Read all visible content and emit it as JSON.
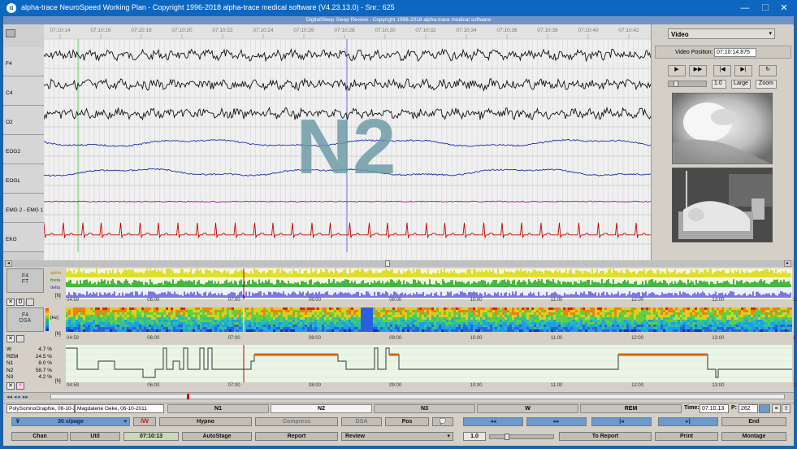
{
  "window": {
    "title": "alpha-trace NeuroSpeed Working Plan - Copyright 1996-2018 alpha-trace medical software (V4.23.13.0) - Snr.: 625",
    "minimize_glyph": "—",
    "maximize_glyph": "☐",
    "close_glyph": "✕",
    "app_glyph": "α"
  },
  "banner": "DigitalSleep Sleep Review - Copyright 1996-2018 alpha-trace medical software",
  "time_ticks": [
    "07:10:14",
    "07:10:16",
    "07:10:18",
    "07:10:20",
    "07:10:22",
    "07:10:24",
    "07:10:26",
    "07:10:28",
    "07:10:30",
    "07:10:32",
    "07:10:34",
    "07:10:36",
    "07:10:38",
    "07:10:40",
    "07:10:42"
  ],
  "channels": [
    "F4",
    "C4",
    "O2",
    "EOG2",
    "EOGL",
    "EMG 2 - EMG 1",
    "EKG"
  ],
  "stage_overlay": "N2",
  "video": {
    "dropdown": "Video",
    "position_label": "Video Position:",
    "position_value": "07:10:14.875",
    "speed_value": "1.0",
    "large_label": "Large",
    "zoom_label": "Zoom"
  },
  "trend_ft": {
    "name_top": "F4",
    "name_bottom": "FT",
    "bands": [
      "alpha",
      "theta",
      "delta"
    ]
  },
  "trend_dsa": {
    "name_top": "F4",
    "name_bottom": "DSA",
    "unit": "[Hz]"
  },
  "hour_axis": {
    "unit": "[h]",
    "ticks": [
      "04:59",
      "06:00",
      "07:00",
      "08:00",
      "09:00",
      "10:00",
      "11:00",
      "12:00",
      "13:00",
      "13:59"
    ]
  },
  "hypno_stats": [
    {
      "stage": "W",
      "pct": "4.7 %"
    },
    {
      "stage": "REM",
      "pct": "24.5 %"
    },
    {
      "stage": "N1",
      "pct": "8.0 %"
    },
    {
      "stage": "N2",
      "pct": "58.7 %"
    },
    {
      "stage": "N3",
      "pct": "4.2 %"
    }
  ],
  "stage_bar": {
    "file": "PolySomnoGraphie, 06-10-2",
    "patient": "Magdalene Geke, 06-10-2011",
    "stages": [
      "N1",
      "N2",
      "N3",
      "W",
      "REM"
    ],
    "time_label": "Time:",
    "time_value": "07.10.13",
    "page_label": "P:",
    "page_value": "262"
  },
  "toolbar1": {
    "page_speed": "30 s/page",
    "hypno": "Hypno",
    "compress": "Compress",
    "dsa": "DSA",
    "pos": "Pos",
    "rewind": "◂◂",
    "forward": "▸▸",
    "prev": "|◂",
    "next": "▸|",
    "end": "End"
  },
  "toolbar2": {
    "chan": "Chan",
    "util": "Util",
    "time": "07:10:13",
    "autostage": "AutoStage",
    "report": "Report",
    "review": "Review",
    "gain": "1.0",
    "to_report": "To Report",
    "print": "Print",
    "montage": "Montage"
  },
  "colors": {
    "eeg": "#111111",
    "eog": "#1d2fb5",
    "emg": "#a010a0",
    "ekg": "#cc0000",
    "stage_text": "#6b9aa6",
    "alpha": "#d9d900",
    "theta": "#18a818",
    "delta": "#2a2acd"
  }
}
